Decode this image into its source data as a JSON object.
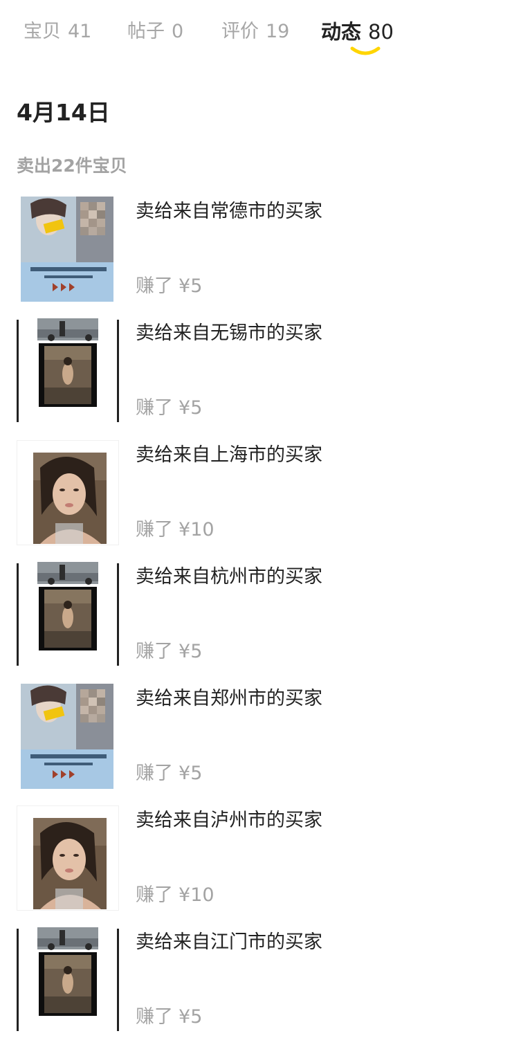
{
  "tabs": [
    {
      "label": "宝贝",
      "count": "41",
      "active": false
    },
    {
      "label": "帖子",
      "count": "0",
      "active": false
    },
    {
      "label": "评价",
      "count": "19",
      "active": false
    },
    {
      "label": "动态",
      "count": "80",
      "active": true
    }
  ],
  "colors": {
    "accent": "#ffd500",
    "text_primary": "#222222",
    "text_secondary": "#a3a3a3"
  },
  "feed": {
    "date": "4月14日",
    "summary": "卖出22件宝贝",
    "items": [
      {
        "buyer_text": "卖给来自常德市的买家",
        "earned_label": "赚了",
        "currency": "¥",
        "amount": "5",
        "thumb": "poster-photo"
      },
      {
        "buyer_text": "卖给来自无锡市的买家",
        "earned_label": "赚了",
        "currency": "¥",
        "amount": "5",
        "thumb": "collage-photo"
      },
      {
        "buyer_text": "卖给来自上海市的买家",
        "earned_label": "赚了",
        "currency": "¥",
        "amount": "10",
        "thumb": "portrait-photo"
      },
      {
        "buyer_text": "卖给来自杭州市的买家",
        "earned_label": "赚了",
        "currency": "¥",
        "amount": "5",
        "thumb": "collage-photo"
      },
      {
        "buyer_text": "卖给来自郑州市的买家",
        "earned_label": "赚了",
        "currency": "¥",
        "amount": "5",
        "thumb": "poster-photo"
      },
      {
        "buyer_text": "卖给来自泸州市的买家",
        "earned_label": "赚了",
        "currency": "¥",
        "amount": "10",
        "thumb": "portrait-photo"
      },
      {
        "buyer_text": "卖给来自江门市的买家",
        "earned_label": "赚了",
        "currency": "¥",
        "amount": "5",
        "thumb": "collage-photo"
      }
    ]
  }
}
